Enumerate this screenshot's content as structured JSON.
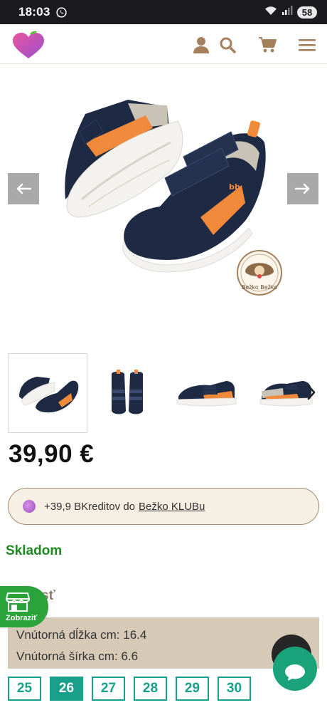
{
  "status_bar": {
    "time": "18:03",
    "battery": "58"
  },
  "header": {
    "icons": [
      "user-icon",
      "search-icon",
      "cart-icon",
      "menu-icon"
    ]
  },
  "hero": {
    "badge_text": "Bežko Bežko",
    "arrow_prev": "←",
    "arrow_next": "→"
  },
  "thumbnails": {
    "count": 4,
    "active_index": 0,
    "next_glyph": "›"
  },
  "product": {
    "price": "39,90 €",
    "credits_prefix": "+39,9 BKreditov do",
    "credits_link": "Bežko KLUBu",
    "stock": "Skladom",
    "section_title": "sť",
    "specs": [
      "Vnútorná dĺžka cm: 16.4",
      "Vnútorná šírka cm: 6.6"
    ]
  },
  "badge": {
    "label": "Zobraziť"
  },
  "sizes": {
    "options": [
      "25",
      "26",
      "27",
      "28",
      "29",
      "30"
    ],
    "selected": "26"
  },
  "colors": {
    "accent": "#18a08a",
    "stock_green": "#1f8a1f",
    "brown": "#a58a6c",
    "specs_bg": "#d6c9b6",
    "credits_bg": "#f6efe4"
  }
}
